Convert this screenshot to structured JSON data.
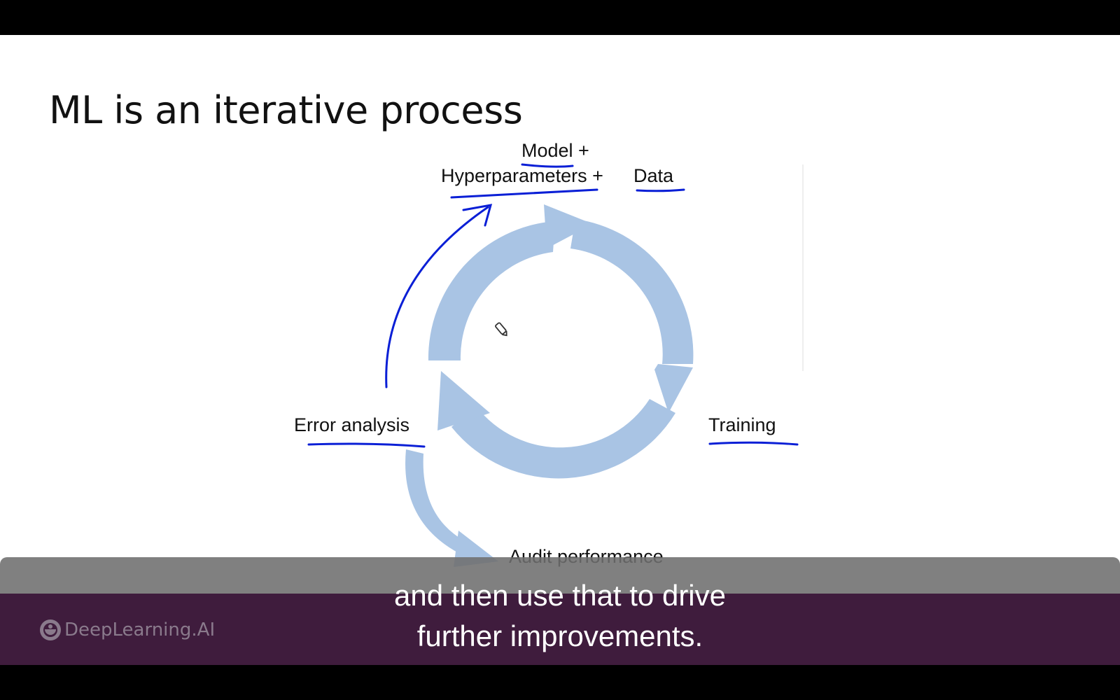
{
  "slide": {
    "title": "ML is an iterative process",
    "diagram": {
      "label_model": "Model +",
      "label_hyperparameters": "Hyperparameters +",
      "label_data": "Data",
      "label_error_analysis": "Error analysis",
      "label_training": "Training",
      "label_audit_performance": "Audit performance"
    },
    "colors": {
      "cycle_arrow": "#a9c4e4",
      "pen_annotation": "#0a1fd6"
    },
    "icons": [
      "pencil-cursor-icon"
    ]
  },
  "footer": {
    "logo_text": "DeepLearning.AI",
    "background": "#3f1c3d"
  },
  "subtitle": {
    "line1": "and then use that to drive",
    "line2": "further improvements."
  }
}
